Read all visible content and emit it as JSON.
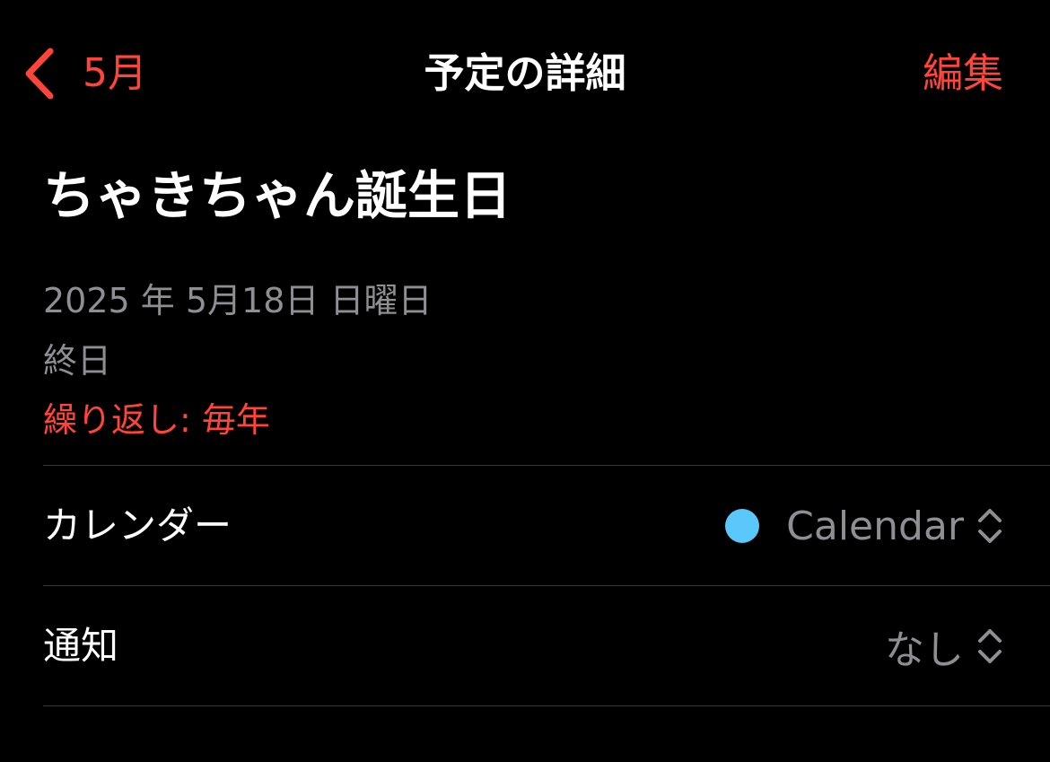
{
  "nav": {
    "back_label": "5月",
    "title": "予定の詳細",
    "edit_label": "編集"
  },
  "event": {
    "title": "ちゃきちゃん誕生日",
    "date": "2025 年 5月18日 日曜日",
    "all_day": "終日",
    "repeat": "繰り返し: 毎年"
  },
  "rows": {
    "calendar": {
      "label": "カレンダー",
      "value": "Calendar",
      "color": "#5ac8fa",
      "icon": "up-down-chevron-icon"
    },
    "alert": {
      "label": "通知",
      "value": "なし",
      "icon": "up-down-chevron-icon"
    }
  },
  "colors": {
    "accent": "#ff453a",
    "background": "#000000",
    "secondary_text": "#8e8e93",
    "separator": "#38383a"
  }
}
